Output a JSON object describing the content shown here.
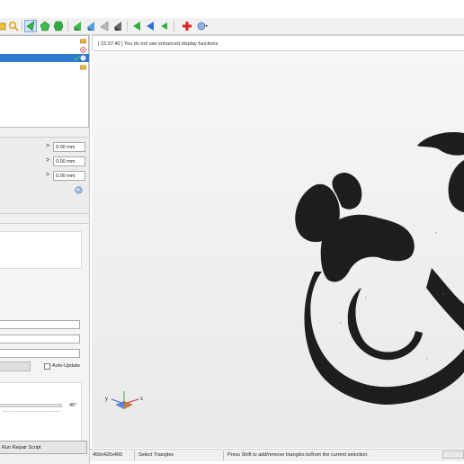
{
  "toolbar": {
    "icons": [
      "folder-icon",
      "search-icon",
      "select-arrow-icon",
      "pentagon-icon",
      "hexagon-icon",
      "view-left-icon",
      "view-left-blue-icon",
      "view-left-grey-icon",
      "view-dark-icon",
      "arrow-green-icon",
      "arrow-blue-icon",
      "arrow-green-small-icon",
      "add-cross-icon",
      "options-dropdown-icon"
    ],
    "accent": "#2e7ad1"
  },
  "tree": {
    "items": [
      {
        "icon": "folder-icon"
      },
      {
        "icon": "target-icon"
      },
      {
        "icon": "check-icon",
        "selected": true
      },
      {
        "icon": "folder-icon"
      }
    ]
  },
  "params": {
    "rows": [
      {
        "arrow": ">",
        "value": "0.00 mm"
      },
      {
        "arrow": ">",
        "value": "0.00 mm"
      },
      {
        "arrow": ">",
        "value": "0.00 mm"
      }
    ]
  },
  "options": {
    "auto_update_label": "Auto-Update",
    "slider_value": "45°"
  },
  "run_repair_label": "Run Repair Script",
  "log": {
    "message": "[ 15:57:40 ]  You do not use enhanced display functions"
  },
  "viewport": {
    "axis_y": "y",
    "axis_x": "x",
    "model_color": "#1c1c1c",
    "background": "#eeeeee"
  },
  "status": {
    "dimensions": "450x420x400",
    "mode": "Select Triangles",
    "hint": "Press Shift to add/remove triangles to/from the current selection."
  }
}
